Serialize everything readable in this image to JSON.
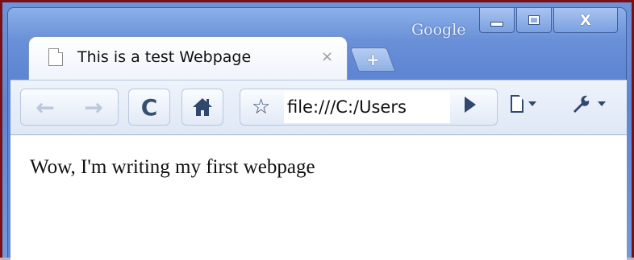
{
  "window": {
    "brand": "Google",
    "close_glyph": "X"
  },
  "tab": {
    "title": "This is a test Webpage",
    "close_glyph": "×",
    "icon": "page-icon"
  },
  "new_tab": {
    "glyph": "+"
  },
  "toolbar": {
    "back_glyph": "←",
    "forward_glyph": "→",
    "reload_glyph": "C",
    "home_icon": "home-icon",
    "star_glyph": "☆",
    "url": "file:///C:/Users",
    "page_menu_icon": "page-menu-icon",
    "wrench_menu_icon": "wrench-icon"
  },
  "content": {
    "text": "Wow, I'm writing my first webpage"
  },
  "colors": {
    "frame": "#6f93d8",
    "border": "#7a1016"
  }
}
